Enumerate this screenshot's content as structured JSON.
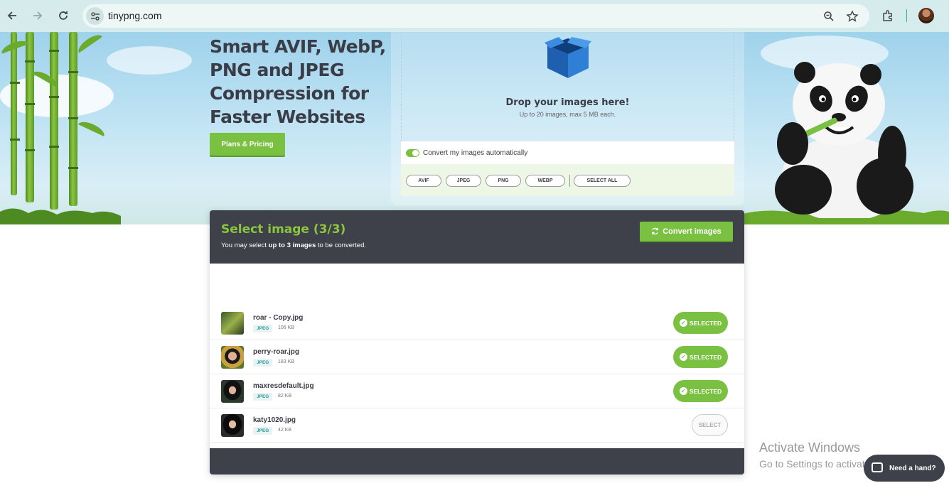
{
  "browser": {
    "url": "tinypng.com",
    "icons": [
      "back-icon",
      "forward-icon",
      "reload-icon",
      "site-info-icon",
      "zoom-icon",
      "bookmark-star-icon",
      "extensions-icon",
      "profile-avatar"
    ]
  },
  "hero": {
    "title": "Smart AVIF, WebP, PNG and JPEG Compression for Faster Websites",
    "plans_button": "Plans & Pricing"
  },
  "dropzone": {
    "title": "Drop your images here!",
    "subtitle": "Up to 20 images, max 5 MB each.",
    "convert_toggle_label": "Convert my images automatically",
    "convert_toggle_on": true,
    "formats": [
      "AVIF",
      "JPEG",
      "PNG",
      "WEBP"
    ],
    "select_all": "SELECT ALL"
  },
  "panel": {
    "title": "Select image (3/3)",
    "subtitle_prefix": "You may select ",
    "subtitle_bold": "up to 3 images",
    "subtitle_suffix": " to be converted.",
    "convert_button": "Convert images",
    "files": [
      {
        "name": "roar - Copy.jpg",
        "type": "JPEG",
        "size": "106 KB",
        "status": "SELECTED",
        "selected": true
      },
      {
        "name": "perry-roar.jpg",
        "type": "JPEG",
        "size": "183 KB",
        "status": "SELECTED",
        "selected": true
      },
      {
        "name": "maxresdefault.jpg",
        "type": "JPEG",
        "size": "82 KB",
        "status": "SELECTED",
        "selected": true
      },
      {
        "name": "katy1020.jpg",
        "type": "JPEG",
        "size": "42 KB",
        "status": "SELECT",
        "selected": false
      }
    ]
  },
  "watermark": {
    "line1": "Activate Windows",
    "line2": "Go to Settings to activate Windows."
  },
  "help_button": "Need a hand?",
  "colors": {
    "accent_green": "#7ac142",
    "title_green": "#8cc63f",
    "panel_dark": "#3e4149"
  }
}
